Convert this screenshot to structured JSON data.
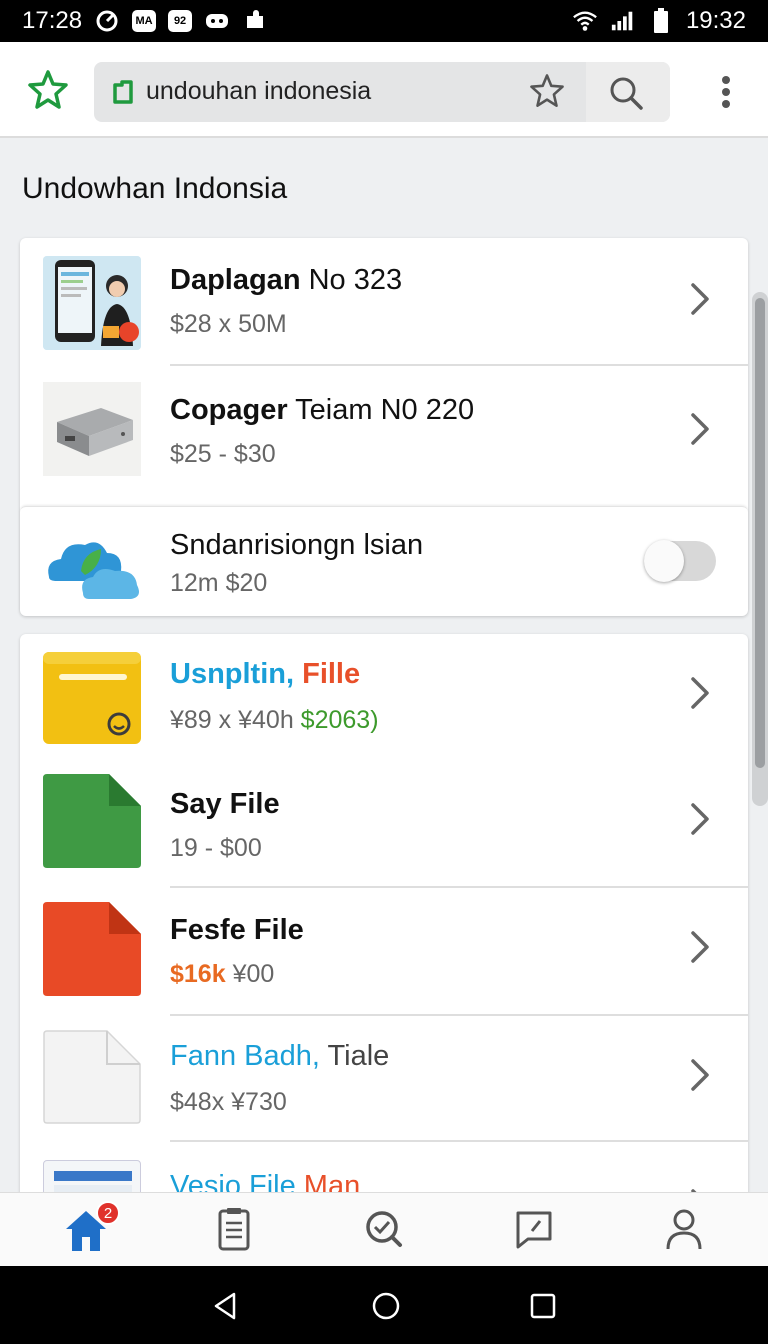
{
  "status_bar": {
    "time_left": "17:28",
    "app_box_1": "MA",
    "app_box_2": "92",
    "time_right": "19:32"
  },
  "browser": {
    "url": "undouhan indonesia"
  },
  "page": {
    "title": "Undowhan Indonsia"
  },
  "list1": [
    {
      "title_bold": "Daplagan",
      "title_rest": " No 323",
      "subtitle": "$28 x  50M"
    },
    {
      "title_bold": "Copager",
      "title_rest": " Teiam N0 220",
      "subtitle": "$25 - $30"
    },
    {
      "title_rest": "Sndanrisiongn lsian",
      "subtitle": "12m $20",
      "toggle_on": false
    }
  ],
  "list2": [
    {
      "title_a": "Usnpltin,",
      "title_b": " Fille",
      "subtitle_a": "¥89 x ¥40h ",
      "subtitle_b": "$2063)"
    },
    {
      "title_bold": "Say File",
      "subtitle": "19 - $00"
    },
    {
      "title_bold": "Fesfe File",
      "subtitle_a": "$16k ",
      "subtitle_b": "¥00"
    },
    {
      "title_a": "Fann Badh,",
      "title_b": " Tiale",
      "subtitle": "$48x  ¥730"
    },
    {
      "title_a": "Vesio File",
      "title_b": " Man"
    }
  ],
  "tabbar": {
    "home_badge": "2",
    "icons": [
      "home-icon",
      "clipboard-icon",
      "search-check-icon",
      "chat-icon",
      "profile-icon"
    ]
  },
  "colors": {
    "accent_green": "#1f9a3e",
    "link_blue": "#1a9fd8",
    "orange_red": "#e8502a",
    "price_green": "#3d9a2c",
    "home_blue": "#1f6fc8"
  }
}
